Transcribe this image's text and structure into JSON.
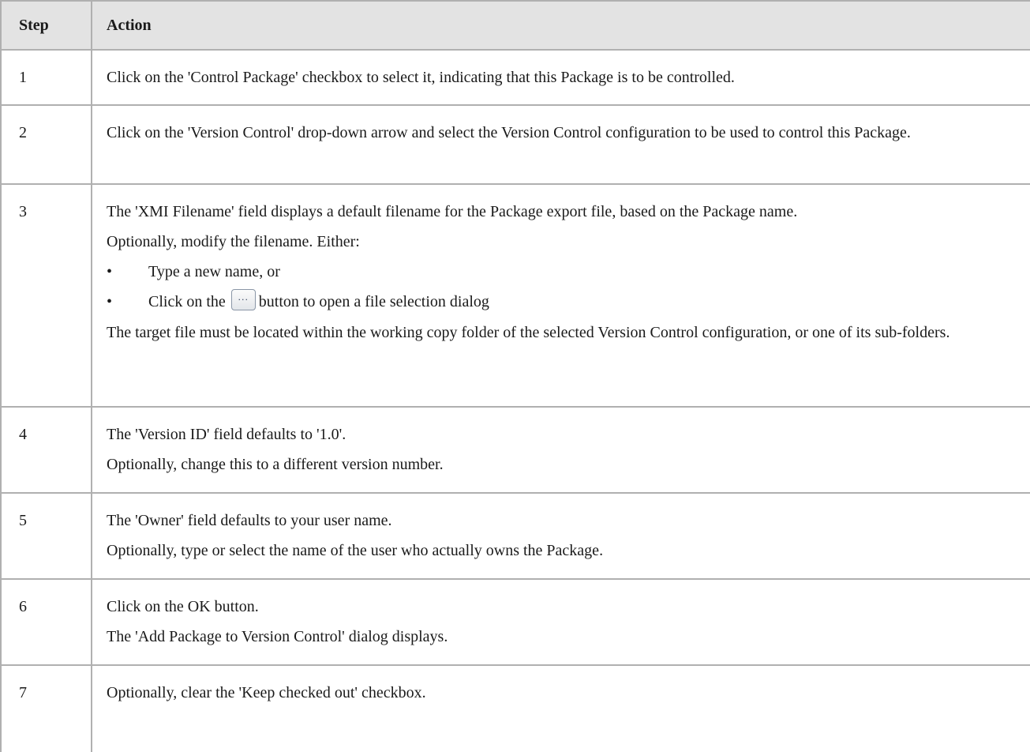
{
  "table": {
    "headers": [
      "Step",
      "Action"
    ],
    "rows": [
      {
        "step": "1",
        "paragraphs": [
          "Click on the 'Control Package' checkbox to select it, indicating that this Package is to be controlled."
        ]
      },
      {
        "step": "2",
        "paragraphs": [
          "Click on the 'Version Control' drop-down arrow and select the Version Control configuration to be used to control this Package."
        ]
      },
      {
        "step": "3",
        "paragraphs": [
          "The 'XMI Filename' field displays a default filename for the Package export file, based on the Package name.",
          "Optionally, modify the filename. Either:"
        ],
        "bullets": [
          "Type a new name, or",
          {
            "before": "Click on the",
            "button_glyph": "...",
            "after": "button to open a file selection dialog"
          }
        ],
        "footer": "The target file must be located within the working copy folder of the selected Version Control configuration, or one of its sub-folders."
      },
      {
        "step": "4",
        "paragraphs": [
          "The 'Version ID' field defaults to '1.0'.",
          "Optionally, change this to a different version number."
        ]
      },
      {
        "step": "5",
        "paragraphs": [
          "The 'Owner' field defaults to your user name.",
          "Optionally, type or select the name of the user who actually owns the Package."
        ]
      },
      {
        "step": "6",
        "paragraphs": [
          "Click on the OK button.",
          "The 'Add Package to Version Control' dialog displays."
        ]
      },
      {
        "step": "7",
        "paragraphs": [
          "Optionally, clear the 'Keep checked out' checkbox."
        ]
      }
    ],
    "bullet_glyph": "•"
  },
  "colors": {
    "header_bg": "#e3e3e3",
    "border": "#b0b0b0",
    "text": "#1a1a1a"
  }
}
